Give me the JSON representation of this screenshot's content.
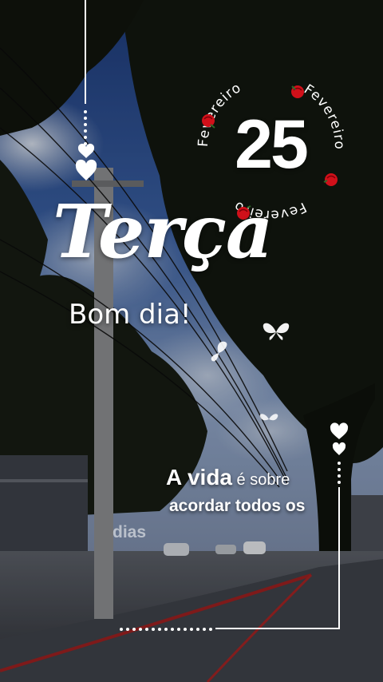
{
  "card": {
    "day_name": "Terça",
    "greeting": "Bom dia!",
    "day_number": "25",
    "month_ring": [
      "Fevereiro",
      "Fevereiro",
      "Fevereiro"
    ],
    "quote": {
      "strong": "A vida",
      "rest": " é sobre",
      "line2": "acordar todos os",
      "line3": "dias"
    }
  },
  "colors": {
    "sky": "#3a5fa0",
    "foliage": "#151a12",
    "rose": "#d0101a",
    "text": "#ffffff"
  },
  "icons": [
    "heart-icon",
    "butterfly-icon",
    "rose-icon"
  ]
}
